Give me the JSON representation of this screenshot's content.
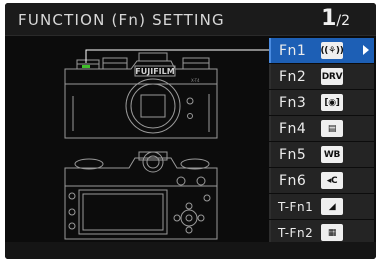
{
  "header": {
    "title": "FUNCTION (Fn) SETTING",
    "page_current": "1",
    "page_total": "/2"
  },
  "camera": {
    "brand_text": "FUJIFILM",
    "model_text": "X-T4"
  },
  "fn_items": [
    {
      "label": "Fn1",
      "icon": "hand-stabilizer-icon",
      "icon_text": "((⚘))",
      "selected": true
    },
    {
      "label": "Fn2",
      "icon": "drive-mode-icon",
      "icon_text": "DRV",
      "selected": false
    },
    {
      "label": "Fn3",
      "icon": "metering-icon",
      "icon_text": "[◉]",
      "selected": false
    },
    {
      "label": "Fn4",
      "icon": "film-simulation-icon",
      "icon_text": "▤",
      "selected": false
    },
    {
      "label": "Fn5",
      "icon": "white-balance-icon",
      "icon_text": "WB",
      "selected": false
    },
    {
      "label": "Fn6",
      "icon": "color-chrome-icon",
      "icon_text": "◂C",
      "selected": false
    },
    {
      "label": "T-Fn1",
      "icon": "histogram-icon",
      "icon_text": "◢",
      "selected": false
    },
    {
      "label": "T-Fn2",
      "icon": "electronic-level-icon",
      "icon_text": "▦",
      "selected": false
    }
  ],
  "colors": {
    "selected": "#1d5fb5",
    "camera_lines": "#9a9a9a",
    "highlight_button": "#3fbf2a",
    "leader_line": "#ffffff"
  }
}
